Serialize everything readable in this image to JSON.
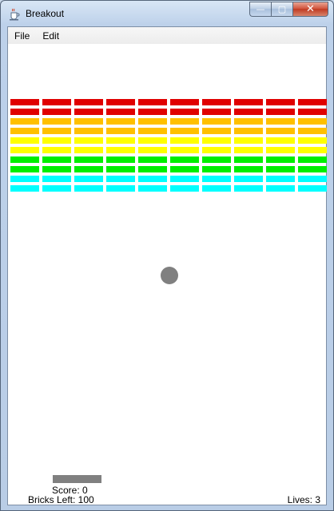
{
  "window": {
    "title": "Breakout",
    "icon": "java-coffee-cup-icon",
    "caption": {
      "minimize": "—",
      "maximize": "▢",
      "close": "✕"
    }
  },
  "menu": [
    {
      "label": "File"
    },
    {
      "label": "Edit"
    }
  ],
  "game": {
    "brick_rows": 10,
    "brick_columns": 10,
    "row_colors": [
      "#e00000",
      "#e00000",
      "#ffc000",
      "#ffc000",
      "#ffff00",
      "#ffff00",
      "#00ee00",
      "#00ee00",
      "#00ffff",
      "#00ffff"
    ],
    "ball_color": "#808080",
    "paddle_color": "#808080",
    "score_text": "Score: 0",
    "bricks_left_text": "Bricks Left: 100",
    "lives_text": "Lives: 3"
  }
}
